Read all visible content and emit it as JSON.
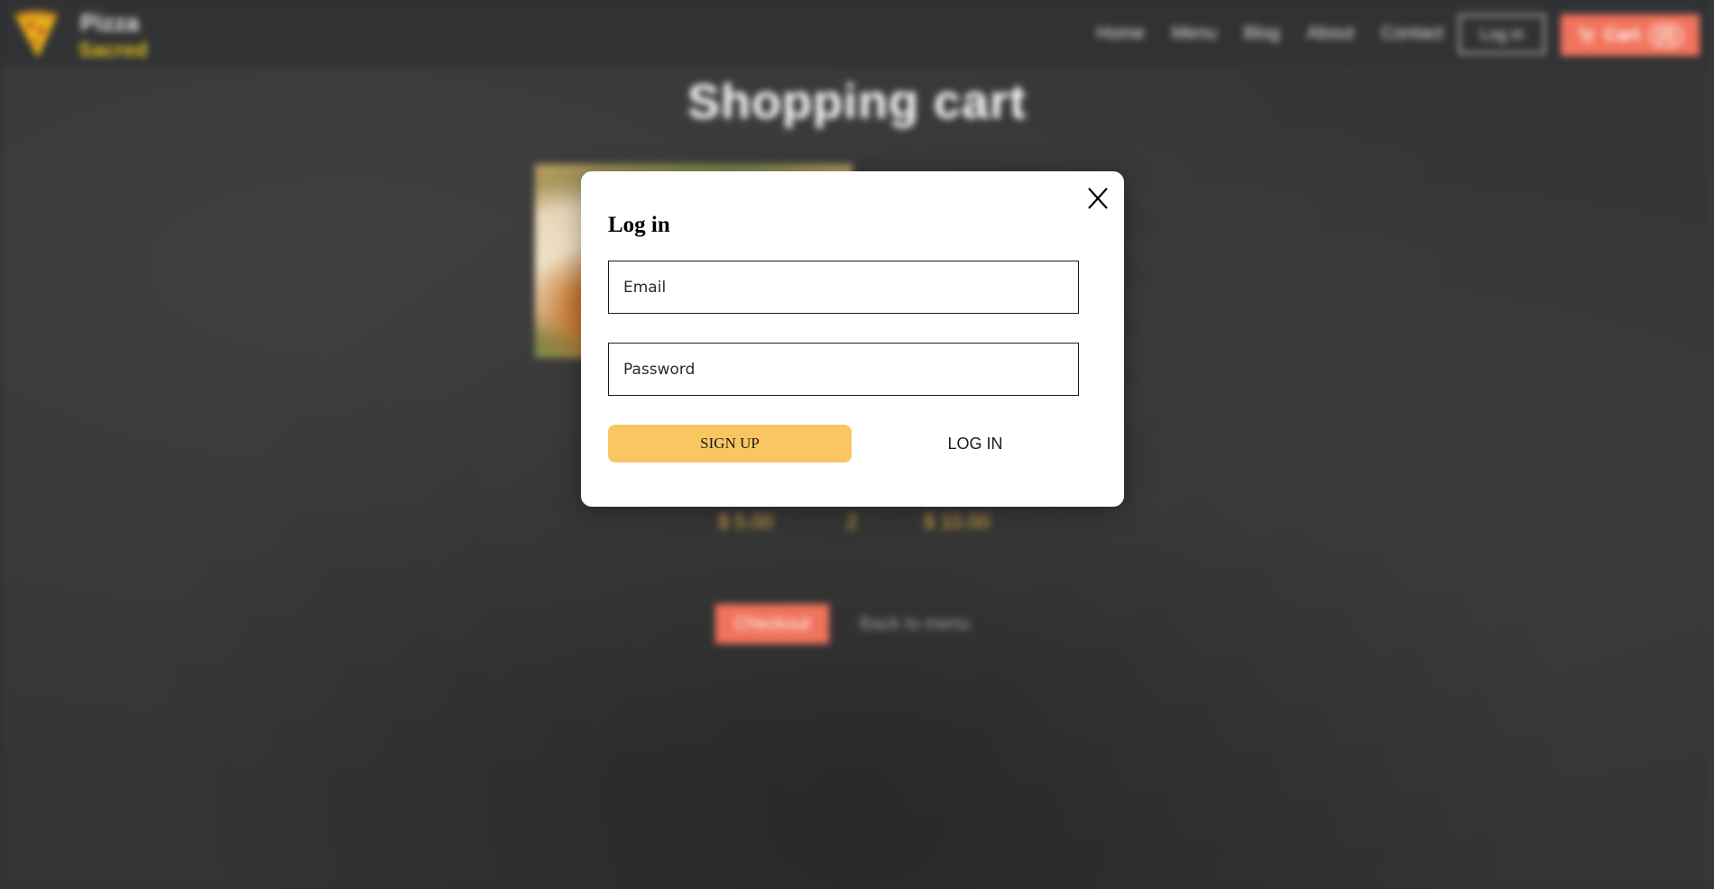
{
  "navbar": {
    "brand": {
      "line1": "Pizza",
      "line2": "Sacred"
    },
    "links": [
      "Home",
      "Menu",
      "Blog",
      "About",
      "Contact"
    ],
    "login_label": "Log in",
    "cart_label": "Cart",
    "cart_count": "(0)"
  },
  "cart_page": {
    "title": "Shopping cart",
    "unit_price": "$ 5.00",
    "quantity": "2",
    "total": "$ 10.00",
    "checkout_label": "Checkout",
    "back_label": "Back to menu"
  },
  "login_modal": {
    "title": "Log in",
    "close_label": "X",
    "email_placeholder": "Email",
    "password_placeholder": "Password",
    "signup_label": "SIGN UP",
    "login_label": "LOG IN"
  },
  "colors": {
    "accent": "#f1735c",
    "signup": "#f9c662",
    "brand_yellow": "#e6c11a",
    "navbar_bg": "#303234"
  },
  "icons": {
    "logo": "pizza-slice-icon",
    "cart": "cart-icon",
    "close": "close-icon"
  }
}
